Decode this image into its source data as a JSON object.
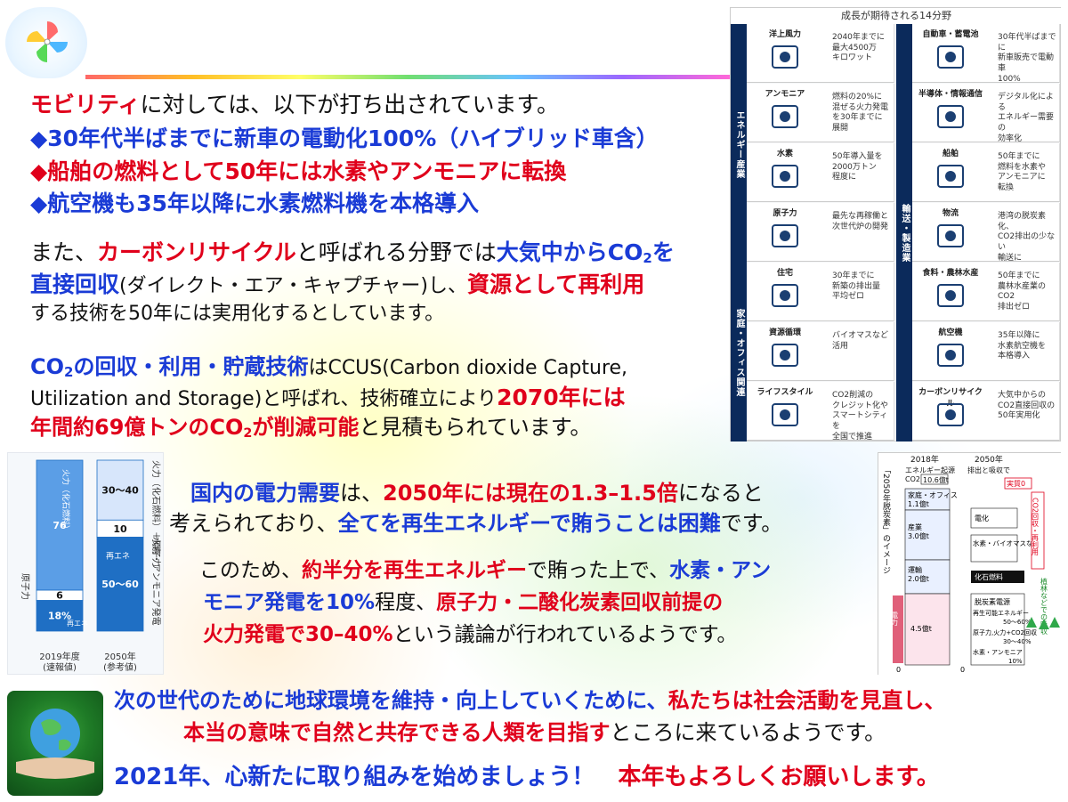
{
  "intro": {
    "highlight": "モビリティ",
    "rest": "に対しては、以下が打ち出されています。"
  },
  "bullets": [
    "◆30年代半ばまでに新車の電動化100%（ハイブリッド車含）",
    "◆船舶の燃料として50年には水素やアンモニアに転換",
    "◆航空機も35年以降に水素燃料機を本格導入"
  ],
  "para2": {
    "p1": "また、",
    "p2": "カーボンリサイクル",
    "p3": "と呼ばれる分野では",
    "p4": "大気中からCO",
    "sub": "2",
    "p5": "を",
    "l2a": "直接回収",
    "l2b": "(ダイレクト・エア・キャプチャー)し、",
    "l2c": "資源として再利用",
    "l3": "する技術を50年には実用化するとしています。"
  },
  "para3": {
    "a1": "CO",
    "sub": "2",
    "a2": "の回収・利用・貯蔵技術",
    "a3": "はCCUS(Carbon dioxide Capture,",
    "b1": "Utilization and Storage)と呼ばれ、技術確立により",
    "b2": "2070年には",
    "c1": "年間約69億トンのCO",
    "c2": "が削減可能",
    "c3": "と見積もられています。"
  },
  "para4": {
    "a1": "国内の電力需要",
    "a2": "は、",
    "a3": "2050年には現在の1.3–1.5倍",
    "a4": "になると",
    "b1": "考えられており、",
    "b2": "全てを再生エネルギーで賄うことは困難",
    "b3": "です。"
  },
  "para5": {
    "a1": "このため、",
    "a2": "約半分を再生エネルギー",
    "a3": "で賄った上で、",
    "a4": "水素・アン",
    "b1": "モニア発電を10%",
    "b2": "程度、",
    "b3": "原子力・二酸化炭素回収前提の",
    "c1": "火力発電で30–40%",
    "c2": "という議論が行われているようです。"
  },
  "para6": {
    "a1": "次の世代のために地球環境を維持・向上",
    "a2": "していくために、",
    "a3": "私たちは社会活動を見直し、",
    "b1": "本当の意味で自然と共存できる人類を目指す",
    "b2": "ところに来ているようです。"
  },
  "para7": {
    "a1": "2021年、心新たに取り組みを始めましょう！",
    "a2": "本年もよろしくお願いします。"
  },
  "infographic": {
    "title": "成長が期待される14分野",
    "side_labels": [
      "エネルギー産業",
      "家庭・オフィス関連",
      "輸送・製造業"
    ],
    "left_cells": [
      {
        "name": "洋上風力",
        "icon": "wind-turbine-icon",
        "desc": "2040年までに\n最大4500万\nキロワット"
      },
      {
        "name": "アンモニア",
        "icon": "ammonia-molecule-icon",
        "desc": "燃料の20%に\n混ぜる火力発電\nを30年までに\n展開"
      },
      {
        "name": "水素",
        "icon": "hydrogen-pump-icon",
        "desc": "50年導入量を\n2000万トン\n程度に"
      },
      {
        "name": "原子力",
        "icon": "nuclear-plant-icon",
        "desc": "最先な再稼働と\n次世代炉の開発"
      },
      {
        "name": "住宅",
        "icon": "house-icon",
        "desc": "30年までに\n新築の排出量\n平均ゼロ"
      },
      {
        "name": "資源循環",
        "icon": "recycle-icon",
        "desc": "バイオマスなど\n活用"
      },
      {
        "name": "ライフスタイル",
        "icon": "city-icon",
        "desc": "CO2削減の\nクレジット化や\nスマートシティを\n全国で推進"
      }
    ],
    "right_cells": [
      {
        "name": "自動車・蓄電池",
        "icon": "car-icon",
        "desc": "30年代半ばまでに\n新車販売で電動車\n100%"
      },
      {
        "name": "半導体・情報通信",
        "icon": "chip-icon",
        "desc": "デジタル化による\nエネルギー需要の\n効率化"
      },
      {
        "name": "船舶",
        "icon": "ship-icon",
        "desc": "50年までに\n燃料を水素や\nアンモニアに\n転換"
      },
      {
        "name": "物流",
        "icon": "train-icon",
        "desc": "港湾の脱炭素化、\nCO2排出の少ない\n輸送に"
      },
      {
        "name": "食料・農林水産",
        "icon": "rice-icon",
        "desc": "50年までに\n農林水産業のCO2\n排出ゼロ"
      },
      {
        "name": "航空機",
        "icon": "airplane-icon",
        "desc": "35年以降に\n水素航空機を\n本格導入"
      },
      {
        "name": "カーボンリサイクル",
        "icon": "co2-icon",
        "desc": "大気中からの\nCO2直接回収の\n50年実用化"
      }
    ]
  },
  "chart_data": [
    {
      "type": "bar",
      "title": "",
      "categories": [
        "2019年度\n(速報値)",
        "2050年\n(参考値)"
      ],
      "series_2019": [
        {
          "name": "再エネ",
          "value": 18,
          "label": "18%"
        },
        {
          "name": "原子力",
          "value": 6,
          "label": "6"
        },
        {
          "name": "火力（化石燃料）",
          "value": 76,
          "label": "76"
        }
      ],
      "series_2050": [
        {
          "name": "再エネ",
          "value": 55,
          "label": "50〜60"
        },
        {
          "name": "水素・アンモニア発電",
          "value": 10,
          "label": "10"
        },
        {
          "name": "火力（化石燃料）＋原子力",
          "value": 35,
          "label": "30〜40"
        }
      ],
      "side_labels": [
        "原子力",
        "火力（化石燃料）＋原子力",
        "水素・アンモニア発電"
      ],
      "cat_labels": [
        "2019年度",
        "(速報値)",
        "2050年",
        "(参考値)"
      ],
      "ylim": [
        0,
        100
      ]
    }
  ],
  "flow": {
    "vertical_title": "「2050年脱炭素」のイメージ",
    "year_2018": "2018年",
    "year_2050": "2050年",
    "h_2018": "エネルギー起源",
    "h_co2": "CO2",
    "h_total": "10.6億t",
    "h_2050": "排出と吸収で",
    "jisshitsu": "実質0",
    "left_items": [
      {
        "name": "家庭・オフィス",
        "value": "1.1億t"
      },
      {
        "name": "産業",
        "value": "3.0億t"
      },
      {
        "name": "運輸",
        "value": "2.0億t"
      },
      {
        "name": "電力",
        "value": "4.5億t"
      }
    ],
    "right_items": [
      "電化",
      "水素・バイオマスなど",
      "化石燃料"
    ],
    "power": {
      "title": "脱炭素電源",
      "r1": "再生可能エネルギー",
      "v1": "50〜60%",
      "r2": "原子力,火力+CO2回収",
      "v2": "30〜40%",
      "r3": "水素・アンモニア",
      "v3": "10%"
    },
    "side_red": "CO2回収・再利用",
    "side_green": "植林などでの吸収",
    "zero_label": "0"
  }
}
